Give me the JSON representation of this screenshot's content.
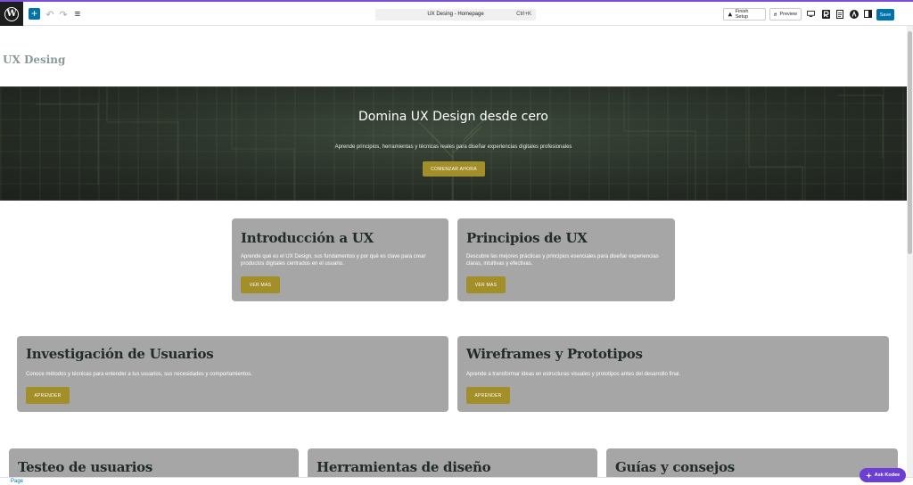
{
  "toolbar": {
    "logo_glyph": "W",
    "add_glyph": "+",
    "undo_glyph": "↶",
    "redo_glyph": "↷",
    "overview_glyph": "≡",
    "command_title": "UX Desing - Homepage",
    "command_shortcut": "Ctrl+K",
    "finish_label": "Finish Setup",
    "preview_label": "Preview",
    "save_label": "Save",
    "accent_color": "#0073aa"
  },
  "site": {
    "title": "UX Desing"
  },
  "hero": {
    "title": "Domina UX Design desde cero",
    "subtitle": "Aprende principios, herramientas y técnicas reales para diseñar experiencias digitales profesionales",
    "button": "COMENZAR AHORA"
  },
  "cards": [
    {
      "title": "Introducción a UX",
      "text": "Aprende qué es el UX Design, sus fundamentos y por qué es clave para crear productos digitales centrados en el usuario.",
      "button": "VER MAS"
    },
    {
      "title": "Principios de UX",
      "text": "Descubre las mejores prácticas y principios esenciales para diseñar experiencias claras, intuitivas y efectivas.",
      "button": "VER MAS"
    },
    {
      "title": "Investigación de Usuarios",
      "text": "Conoce métodos y técnicas para entender a tus usuarios, sus necesidades y comportamientos.",
      "button": "APRENDER"
    },
    {
      "title": "Wireframes y Prototipos",
      "text": "Aprende a transformar ideas en estructuras visuales y prototipos antes del desarrollo final.",
      "button": "APRENDER"
    },
    {
      "title": "Testeo de usuarios"
    },
    {
      "title": "Herramientas de diseño"
    },
    {
      "title": "Guías y consejos"
    }
  ],
  "footer": {
    "breadcrumb": "Page",
    "ask_label": "Ask Kodee"
  },
  "colors": {
    "button_gold": "#a38f2a",
    "card_gray": "#a6a6a6",
    "kodee_purple": "#6b3fd4"
  }
}
